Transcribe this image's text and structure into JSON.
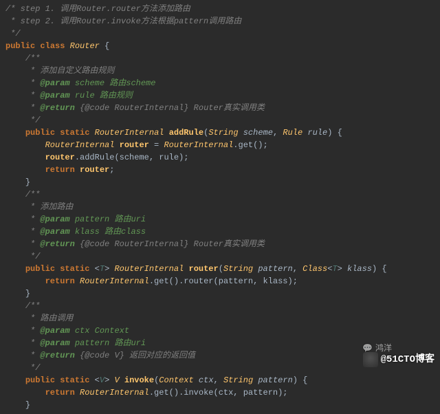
{
  "code": {
    "c_step1": "/* step 1. 调用Router.router方法添加路由",
    "c_step2": " * step 2. 调用Router.invoke方法根据pattern调用路由",
    "c_end": " */",
    "kw_public": "public",
    "kw_class": "class",
    "kw_static": "static",
    "kw_return": "return",
    "cl_Router": "Router",
    "cl_RouterInternal": "RouterInternal",
    "cl_String": "String",
    "cl_Rule": "Rule",
    "cl_Class": "Class",
    "cl_Context": "Context",
    "mt_addRule": "addRule",
    "mt_router": "router",
    "mt_invoke": "invoke",
    "tp_T": "T",
    "tp_V": "V",
    "pr_scheme": "scheme",
    "pr_rule": "rule",
    "pr_pattern": "pattern",
    "pr_klass": "klass",
    "pr_ctx": "ctx",
    "var_router": "router",
    "dc_open": "/**",
    "dc_star": " *",
    "dc_star_close": " */",
    "dc_addRuleDesc": " 添加自定义路由规则",
    "dc_scheme": " scheme 路由scheme",
    "dc_ruleParam": " rule 路由规则",
    "dc_returnRI": " {@code RouterInternal} Router真实调用类",
    "dc_addRoute": " 添加路由",
    "dc_patternUri": " pattern 路由uri",
    "dc_klassClass": " klass 路由class",
    "dc_routeInvoke": " 路由调用",
    "dc_ctx": " ctx Context",
    "dc_returnV": " {@code V} 返回对应的返回值",
    "tg_param": "@param",
    "tg_return": "@return",
    "call_get": ".get()",
    "call_addRule": ".addRule(scheme, rule);",
    "call_routerArgs": ".router(pattern, klass);",
    "call_invokeArgs": ".invoke(ctx, pattern);",
    "eq": " = ",
    "sc": ";",
    "ob": " {",
    "cb": "}",
    "lp": "(",
    "rp": ")",
    "comma": ", ",
    "lt": "<",
    "gt": ">",
    "sp": " "
  },
  "watermark": {
    "main": "@51CTO博客",
    "sub": "鸿洋"
  }
}
